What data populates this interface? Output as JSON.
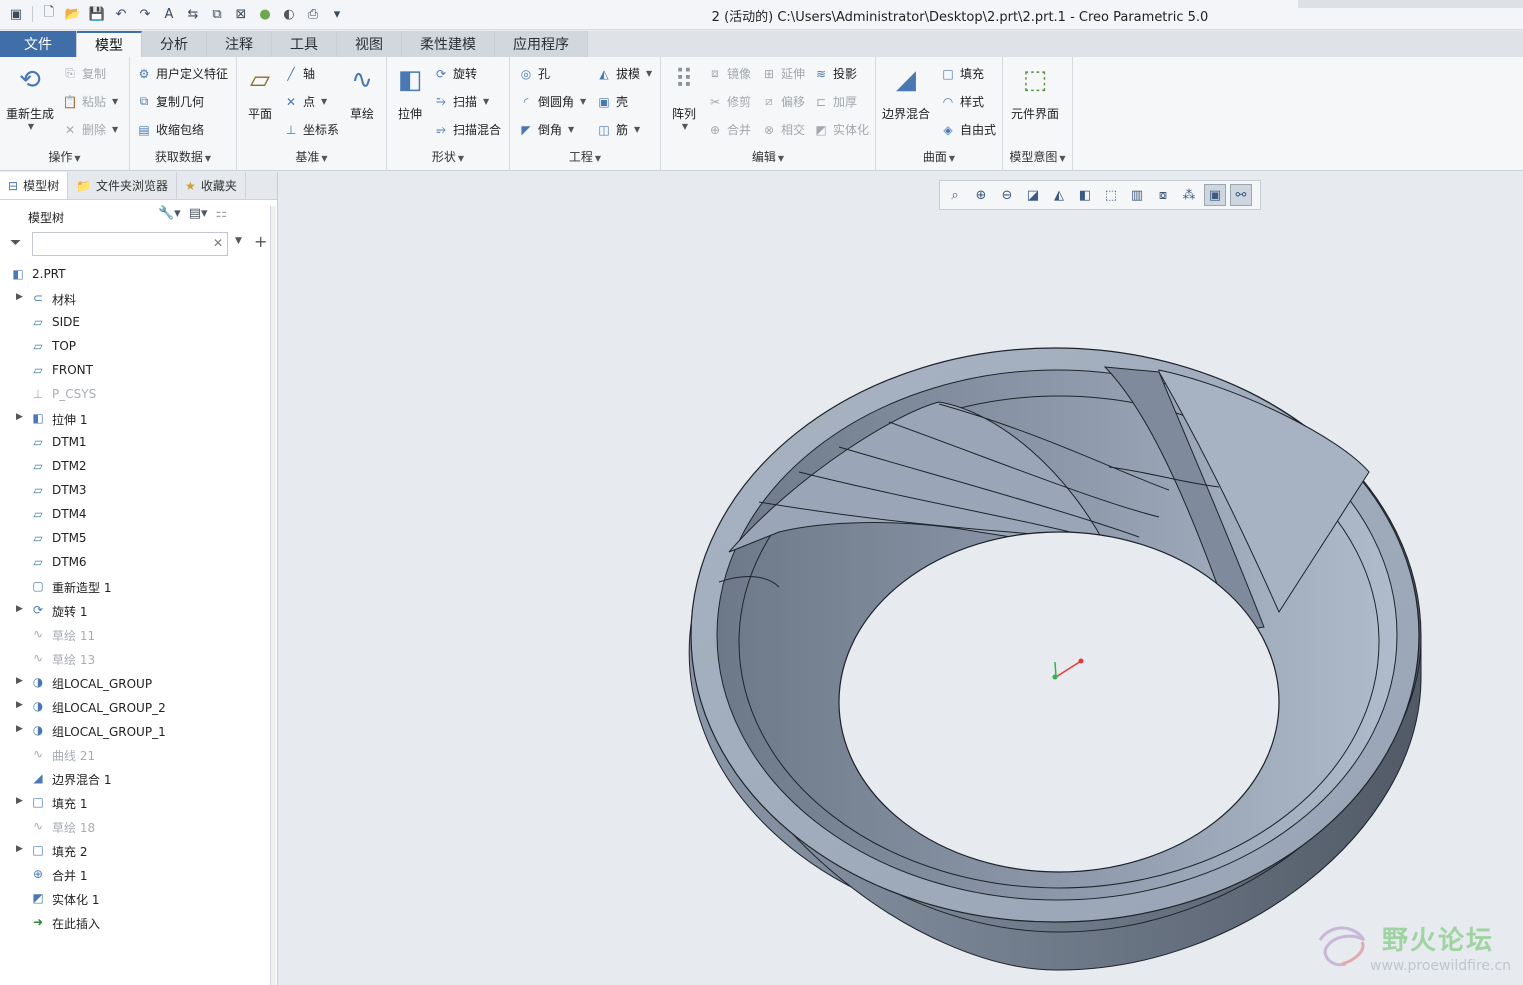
{
  "window": {
    "title": "2 (活动的) C:\\Users\\Administrator\\Desktop\\2.prt\\2.prt.1 - Creo Parametric 5.0"
  },
  "tabs": [
    {
      "label": "文件"
    },
    {
      "label": "模型"
    },
    {
      "label": "分析"
    },
    {
      "label": "注释"
    },
    {
      "label": "工具"
    },
    {
      "label": "视图"
    },
    {
      "label": "柔性建模"
    },
    {
      "label": "应用程序"
    }
  ],
  "ribbon": {
    "operations": {
      "label": "操作",
      "regenerate": "重新生成",
      "copy": "复制",
      "paste": "粘贴",
      "delete": "删除"
    },
    "get_data": {
      "label": "获取数据",
      "udf": "用户定义特征",
      "copy_geom": "复制几何",
      "shrinkwrap": "收缩包络"
    },
    "datum": {
      "label": "基准",
      "plane": "平面",
      "axis": "轴",
      "point": "点",
      "csys": "坐标系",
      "sketch": "草绘"
    },
    "shapes": {
      "label": "形状",
      "extrude": "拉伸",
      "revolve": "旋转",
      "sweep": "扫描",
      "swept_blend": "扫描混合"
    },
    "engineering": {
      "label": "工程",
      "hole": "孔",
      "round": "倒圆角",
      "chamfer": "倒角",
      "draft": "拔模",
      "shell": "壳",
      "rib": "筋"
    },
    "editing": {
      "label": "编辑",
      "pattern": "阵列",
      "mirror": "镜像",
      "extend": "延伸",
      "project": "投影",
      "trim": "修剪",
      "offset": "偏移",
      "thicken": "加厚",
      "merge": "合并",
      "intersect": "相交",
      "solidify": "实体化"
    },
    "surfaces": {
      "label": "曲面",
      "boundary_blend": "边界混合",
      "fill": "填充",
      "style": "样式",
      "freestyle": "自由式"
    },
    "model_intent": {
      "label": "模型意图",
      "component_interface": "元件界面"
    }
  },
  "panel": {
    "tabs": {
      "model_tree": "模型树",
      "folder_browser": "文件夹浏览器",
      "favorites": "收藏夹"
    },
    "tree_title": "模型树",
    "filter": {
      "value": "",
      "placeholder": ""
    }
  },
  "tree": [
    {
      "label": "2.PRT",
      "icon": "part-icon",
      "expand": false,
      "dim": false,
      "root": true
    },
    {
      "label": "材料",
      "icon": "material-icon",
      "expand": true,
      "dim": false
    },
    {
      "label": "SIDE",
      "icon": "datum-plane-icon",
      "expand": false,
      "dim": false
    },
    {
      "label": "TOP",
      "icon": "datum-plane-icon",
      "expand": false,
      "dim": false
    },
    {
      "label": "FRONT",
      "icon": "datum-plane-icon",
      "expand": false,
      "dim": false
    },
    {
      "label": "P_CSYS",
      "icon": "csys-icon",
      "expand": false,
      "dim": true
    },
    {
      "label": "拉伸 1",
      "icon": "extrude-icon",
      "expand": true,
      "dim": false
    },
    {
      "label": "DTM1",
      "icon": "datum-plane-icon",
      "expand": false,
      "dim": false
    },
    {
      "label": "DTM2",
      "icon": "datum-plane-icon",
      "expand": false,
      "dim": false
    },
    {
      "label": "DTM3",
      "icon": "datum-plane-icon",
      "expand": false,
      "dim": false
    },
    {
      "label": "DTM4",
      "icon": "datum-plane-icon",
      "expand": false,
      "dim": false
    },
    {
      "label": "DTM5",
      "icon": "datum-plane-icon",
      "expand": false,
      "dim": false
    },
    {
      "label": "DTM6",
      "icon": "datum-plane-icon",
      "expand": false,
      "dim": false
    },
    {
      "label": "重新造型 1",
      "icon": "restyle-icon",
      "expand": false,
      "dim": false
    },
    {
      "label": "旋转 1",
      "icon": "revolve-icon",
      "expand": true,
      "dim": false
    },
    {
      "label": "草绘 11",
      "icon": "sketch-icon",
      "expand": false,
      "dim": true
    },
    {
      "label": "草绘 13",
      "icon": "sketch-icon",
      "expand": false,
      "dim": true
    },
    {
      "label": "组LOCAL_GROUP",
      "icon": "group-icon",
      "expand": true,
      "dim": false
    },
    {
      "label": "组LOCAL_GROUP_2",
      "icon": "group-icon",
      "expand": true,
      "dim": false
    },
    {
      "label": "组LOCAL_GROUP_1",
      "icon": "group-icon",
      "expand": true,
      "dim": false
    },
    {
      "label": "曲线 21",
      "icon": "curve-icon",
      "expand": false,
      "dim": true
    },
    {
      "label": "边界混合 1",
      "icon": "boundary-blend-icon",
      "expand": false,
      "dim": false
    },
    {
      "label": "填充 1",
      "icon": "fill-icon",
      "expand": true,
      "dim": false
    },
    {
      "label": "草绘 18",
      "icon": "sketch-icon",
      "expand": false,
      "dim": true
    },
    {
      "label": "填充 2",
      "icon": "fill-icon",
      "expand": true,
      "dim": false
    },
    {
      "label": "合并 1",
      "icon": "merge-icon",
      "expand": false,
      "dim": false
    },
    {
      "label": "实体化 1",
      "icon": "solidify-icon",
      "expand": false,
      "dim": false
    },
    {
      "label": "在此插入",
      "icon": "insert-here-icon",
      "expand": false,
      "dim": false
    }
  ],
  "watermark": {
    "text": "野火论坛",
    "url": "www.proewildfire.cn"
  },
  "colors": {
    "accent": "#3f6ea8",
    "model_top": "#a3afbf",
    "model_side": "#6f7b8a"
  }
}
